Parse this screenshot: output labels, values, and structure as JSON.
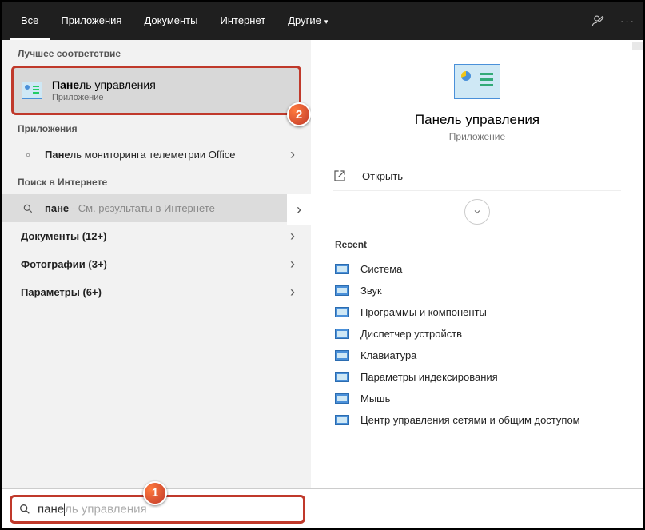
{
  "tabs": {
    "all": "Все",
    "apps": "Приложения",
    "docs": "Документы",
    "web": "Интернет",
    "more": "Другие"
  },
  "sections": {
    "best_match": "Лучшее соответствие",
    "apps": "Приложения",
    "web_search": "Поиск в Интернете",
    "documents": "Документы (12+)",
    "photos": "Фотографии (3+)",
    "settings": "Параметры (6+)"
  },
  "best_match_item": {
    "title_bold": "Пане",
    "title_rest": "ль управления",
    "subtitle": "Приложение"
  },
  "app_item": {
    "bold": "Пане",
    "rest": "ль мониторинга телеметрии Office"
  },
  "web_item": {
    "bold": "пане",
    "rest": " - См. результаты в Интернете"
  },
  "right": {
    "title": "Панель управления",
    "subtitle": "Приложение",
    "open": "Открыть",
    "recent_label": "Recent",
    "recent": [
      "Система",
      "Звук",
      "Программы и компоненты",
      "Диспетчер устройств",
      "Клавиатура",
      "Параметры индексирования",
      "Мышь",
      "Центр управления сетями и общим доступом"
    ]
  },
  "search": {
    "typed": "пане",
    "ghost": "ль управления"
  },
  "callouts": {
    "one": "1",
    "two": "2"
  }
}
